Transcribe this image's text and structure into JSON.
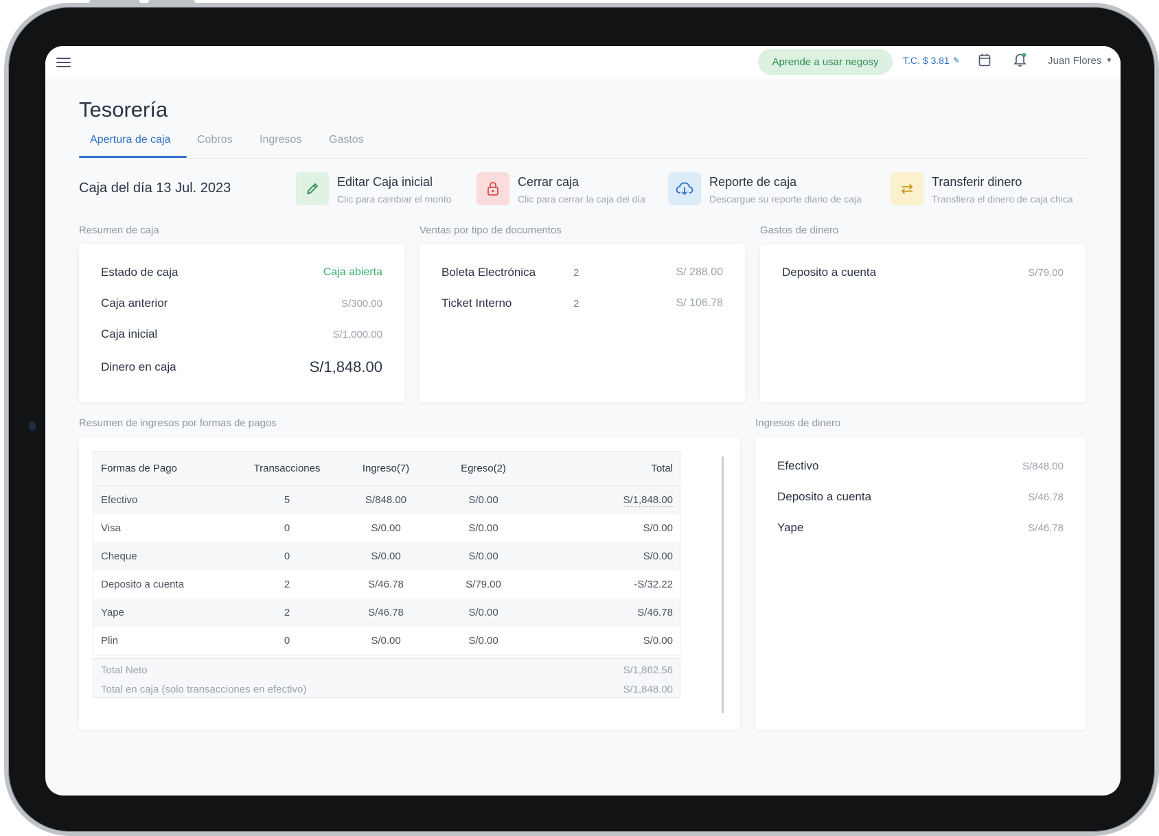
{
  "topbar": {
    "learn_label": "Aprende a usar negosy",
    "exchange_rate": "T.C. $ 3.81",
    "user_name": "Juan Flores"
  },
  "page": {
    "title": "Tesorería",
    "tabs": [
      {
        "label": "Apertura de caja",
        "active": true
      },
      {
        "label": "Cobros",
        "active": false
      },
      {
        "label": "Ingresos",
        "active": false
      },
      {
        "label": "Gastos",
        "active": false
      }
    ],
    "caja_del_dia": "Caja del día 13 Jul. 2023"
  },
  "actions": [
    {
      "title": "Editar Caja inicial",
      "subtitle": "Clic para cambiar el monto",
      "icon": "pencil-icon",
      "color": "#dff2e4"
    },
    {
      "title": "Cerrar caja",
      "subtitle": "Clic para cerrar la caja del día",
      "icon": "lock-icon",
      "color": "#fbdcdc"
    },
    {
      "title": "Reporte de caja",
      "subtitle": "Descargue su reporte diario de caja",
      "icon": "cloud-download-icon",
      "color": "#dcebf8"
    },
    {
      "title": "Transferir dinero",
      "subtitle": "Transfiera el dinero de caja chica",
      "icon": "transfer-icon",
      "color": "#fbf1cc"
    }
  ],
  "resumen_caja": {
    "label": "Resumen de caja",
    "rows": [
      {
        "key": "Estado de caja",
        "value": "Caja abierta"
      },
      {
        "key": "Caja anterior",
        "value": "S/300.00"
      },
      {
        "key": "Caja inicial",
        "value": "S/1,000.00"
      },
      {
        "key": "Dinero en caja",
        "value": "S/1,848.00"
      }
    ]
  },
  "ventas_documentos": {
    "label": "Ventas por tipo de documentos",
    "rows": [
      {
        "name": "Boleta Electrónica",
        "count": "2",
        "amount": "S/ 288.00"
      },
      {
        "name": "Ticket Interno",
        "count": "2",
        "amount": "S/ 106.78"
      }
    ]
  },
  "gastos_dinero": {
    "label": "Gastos de dinero",
    "rows": [
      {
        "key": "Deposito a cuenta",
        "value": "S/79.00"
      }
    ]
  },
  "resumen_ingresos": {
    "label": "Resumen de ingresos por formas de pagos",
    "columns": [
      "Formas de Pago",
      "Transacciones",
      "Ingreso(7)",
      "Egreso(2)",
      "Total"
    ],
    "rows": [
      [
        "Efectivo",
        "5",
        "S/848.00",
        "S/0.00",
        "S/1,848.00"
      ],
      [
        "Visa",
        "0",
        "S/0.00",
        "S/0.00",
        "S/0.00"
      ],
      [
        "Cheque",
        "0",
        "S/0.00",
        "S/0.00",
        "S/0.00"
      ],
      [
        "Deposito a cuenta",
        "2",
        "S/46.78",
        "S/79.00",
        "-S/32.22"
      ],
      [
        "Yape",
        "2",
        "S/46.78",
        "S/0.00",
        "S/46.78"
      ],
      [
        "Plin",
        "0",
        "S/0.00",
        "S/0.00",
        "S/0.00"
      ]
    ],
    "total_neto_label": "Total Neto",
    "total_neto_value": "S/1,862.56",
    "total_caja_label": "Total en caja (solo transacciones en efectivo)",
    "total_caja_value": "S/1,848.00"
  },
  "ingresos_dinero": {
    "label": "Ingresos de dinero",
    "rows": [
      {
        "key": "Efectivo",
        "value": "S/848.00"
      },
      {
        "key": "Deposito a cuenta",
        "value": "S/46.78"
      },
      {
        "key": "Yape",
        "value": "S/46.78"
      }
    ]
  },
  "colors": {
    "accent": "#2f6fc6",
    "success": "#3bb273",
    "learn_bg": "#dcf1e2"
  }
}
